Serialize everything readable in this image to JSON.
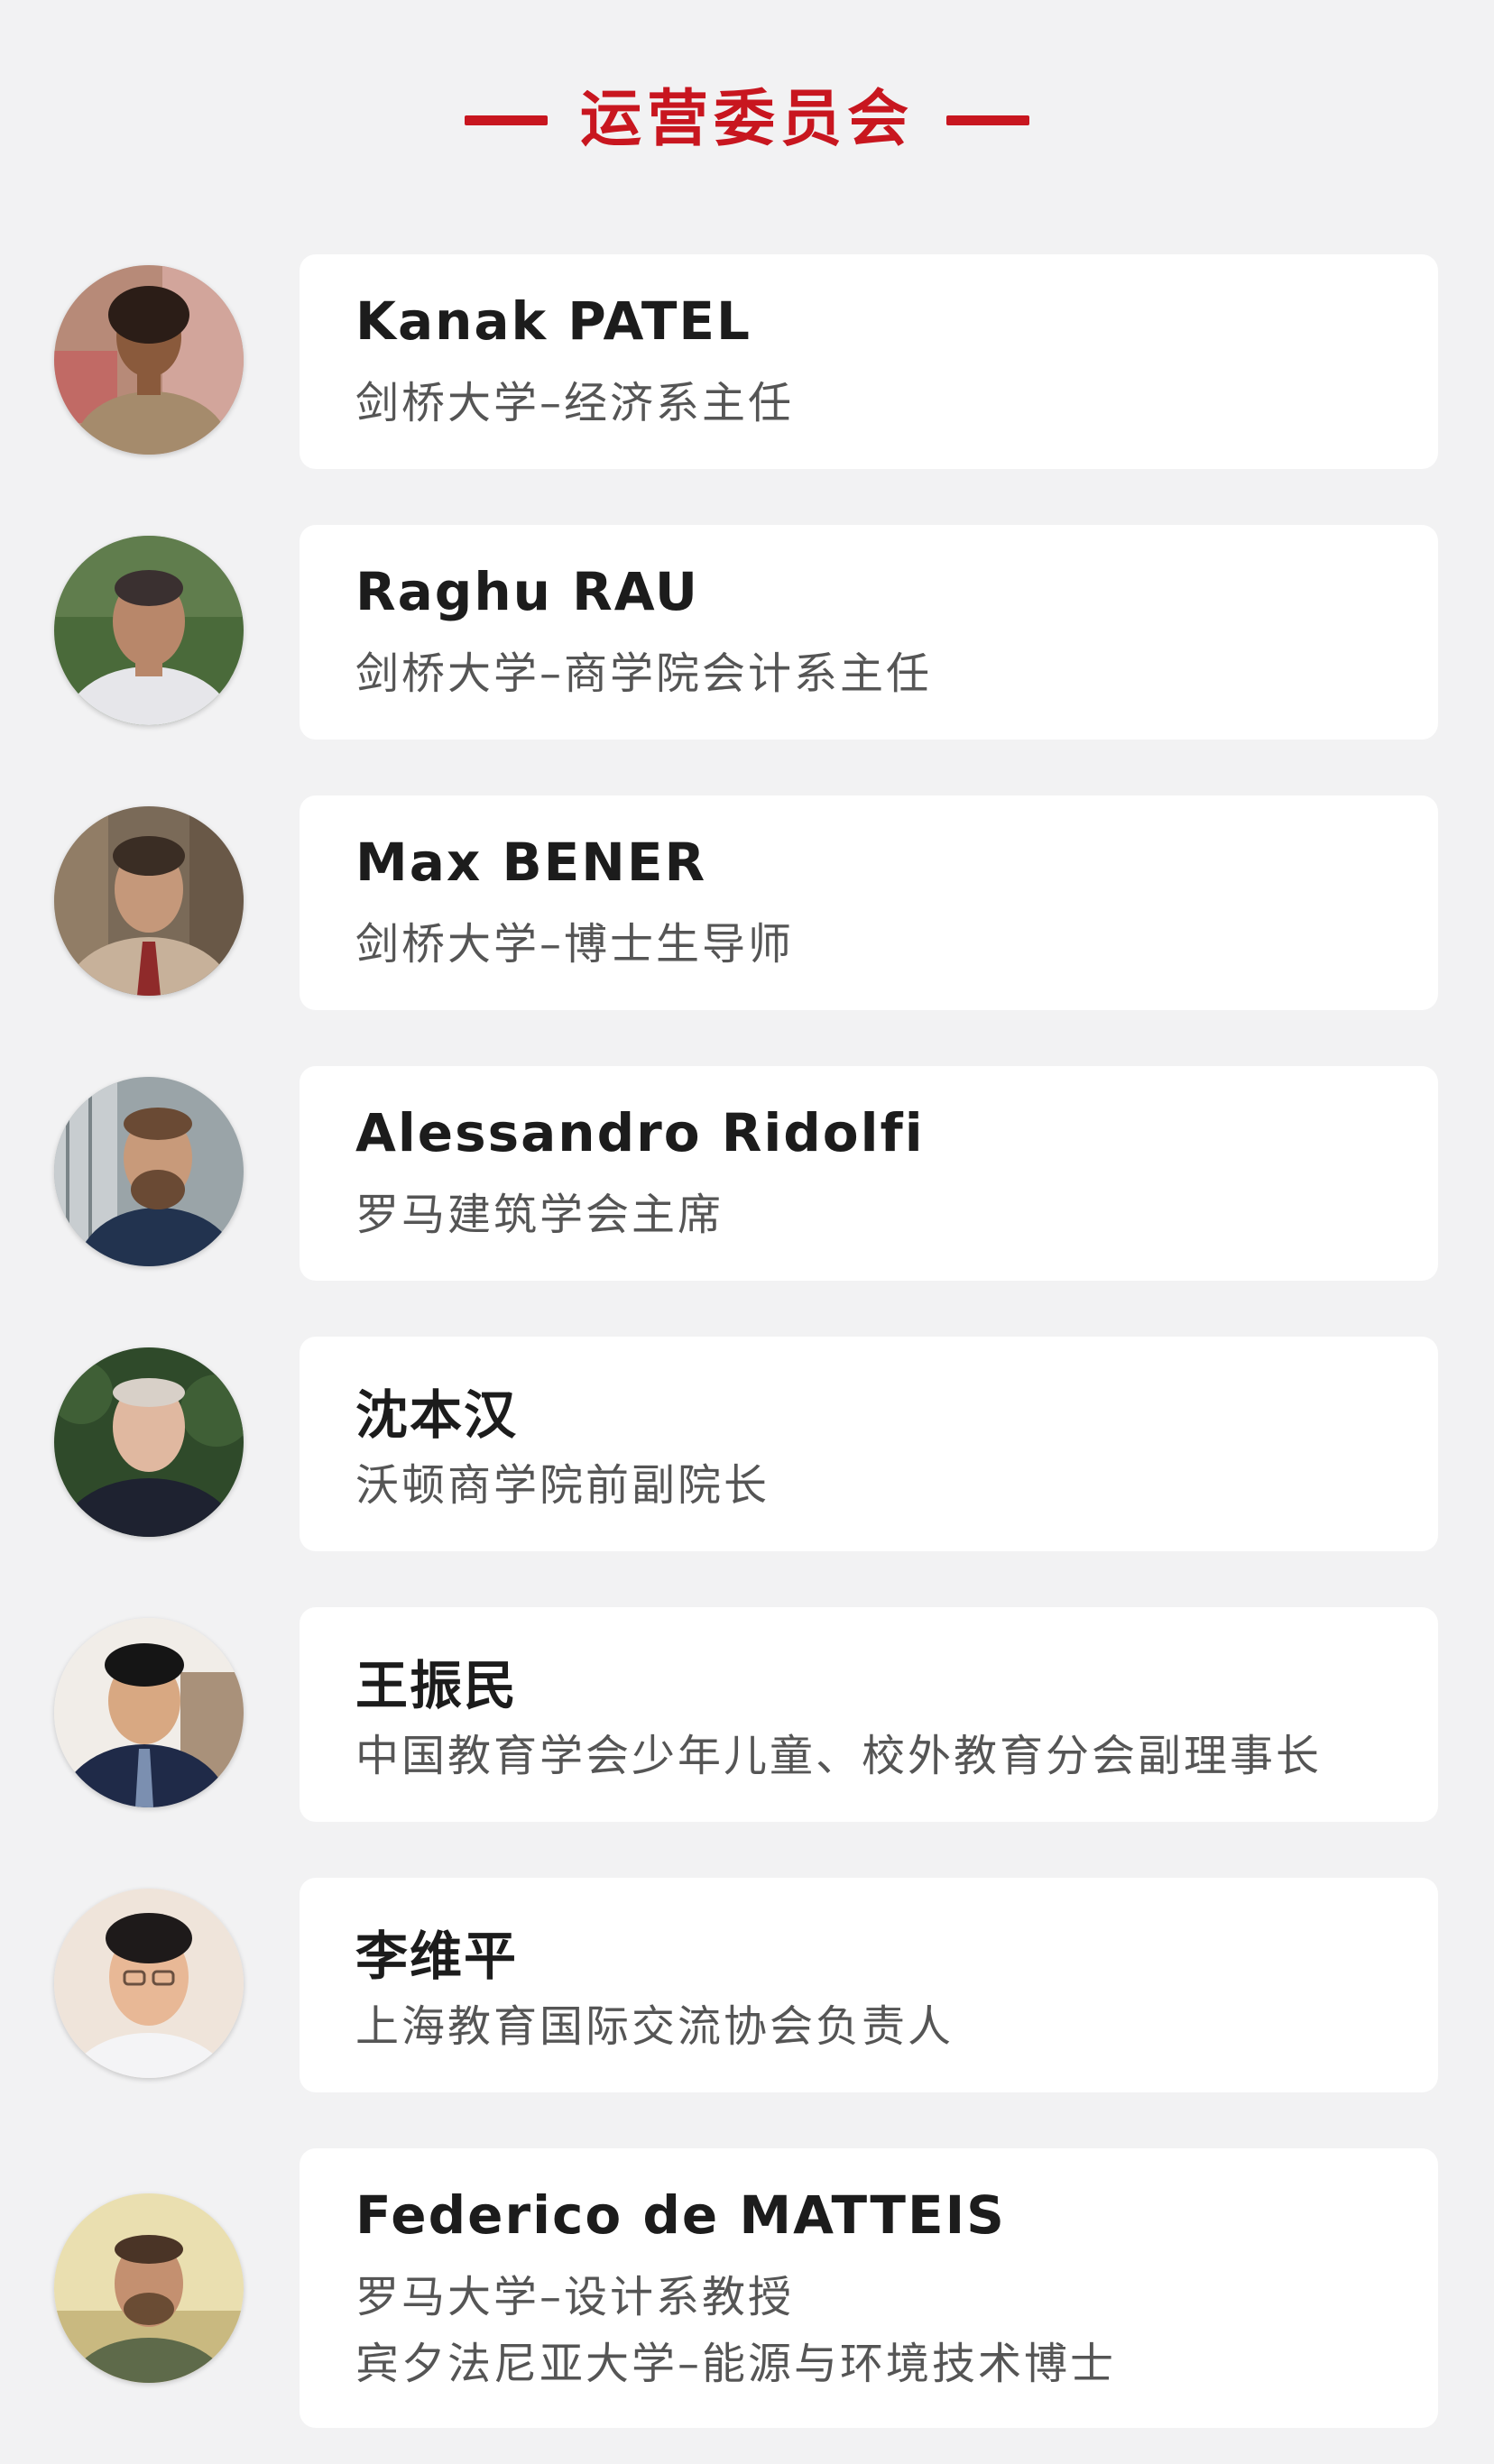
{
  "header": {
    "title": "运营委员会"
  },
  "colors": {
    "accent": "#c8161f",
    "background": "#f2f2f3",
    "card": "#ffffff",
    "name_text": "#1c1c1c",
    "desc_text": "#555555"
  },
  "members": [
    {
      "name": "Kanak PATEL",
      "lines": [
        "剑桥大学–经济系主任"
      ]
    },
    {
      "name": "Raghu RAU",
      "lines": [
        "剑桥大学–商学院会计系主任"
      ]
    },
    {
      "name": "Max BENER",
      "lines": [
        "剑桥大学–博士生导师"
      ]
    },
    {
      "name": "Alessandro Ridolfi",
      "lines": [
        "罗马建筑学会主席"
      ]
    },
    {
      "name": "沈本汉",
      "lines": [
        "沃顿商学院前副院长"
      ]
    },
    {
      "name": "王振民",
      "lines": [
        "中国教育学会少年儿童、校外教育分会副理事长"
      ]
    },
    {
      "name": "李维平",
      "lines": [
        "上海教育国际交流协会负责人"
      ]
    },
    {
      "name": "Federico de MATTEIS",
      "lines": [
        "罗马大学–设计系教授",
        "宾夕法尼亚大学–能源与环境技术博士"
      ]
    }
  ]
}
